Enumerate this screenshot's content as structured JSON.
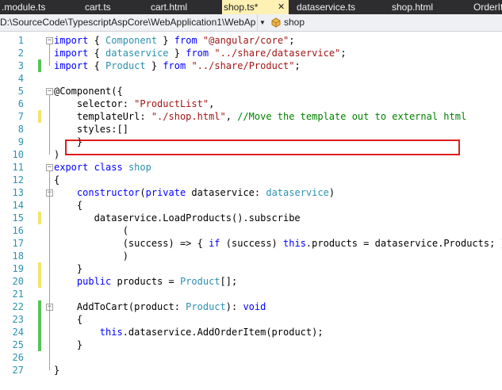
{
  "tabs": [
    {
      "label": ".module.ts"
    },
    {
      "label": "cart.ts"
    },
    {
      "label": "cart.html"
    },
    {
      "label": "shop.ts*",
      "active": true
    },
    {
      "label": "dataservice.ts"
    },
    {
      "label": "shop.html"
    },
    {
      "label": "OrderIt"
    }
  ],
  "navbar": {
    "path": "D:\\SourceCode\\TypescriptAspCore\\WebApplication1\\WebAp",
    "member": "shop"
  },
  "colors": {
    "modified": "#f2e46a",
    "saved": "#57c35a",
    "highlight_box": "#e21b1b",
    "line_numbers": "#2b91af"
  },
  "lines": [
    {
      "n": "1",
      "mark": "",
      "segments": [
        {
          "t": "import",
          "c": "kw"
        },
        {
          "t": " { "
        },
        {
          "t": "Component",
          "c": "ty"
        },
        {
          "t": " } "
        },
        {
          "t": "from",
          "c": "kw"
        },
        {
          "t": " "
        },
        {
          "t": "\"@angular/core\"",
          "c": "st"
        },
        {
          "t": ";"
        }
      ]
    },
    {
      "n": "2",
      "mark": "",
      "segments": [
        {
          "t": "import",
          "c": "kw"
        },
        {
          "t": " { "
        },
        {
          "t": "dataservice",
          "c": "ty"
        },
        {
          "t": " } "
        },
        {
          "t": "from",
          "c": "kw"
        },
        {
          "t": " "
        },
        {
          "t": "\"../share/dataservice\"",
          "c": "st"
        },
        {
          "t": ";"
        }
      ]
    },
    {
      "n": "3",
      "mark": "saved",
      "segments": [
        {
          "t": "import",
          "c": "kw"
        },
        {
          "t": " { "
        },
        {
          "t": "Product",
          "c": "ty"
        },
        {
          "t": " } "
        },
        {
          "t": "from",
          "c": "kw"
        },
        {
          "t": " "
        },
        {
          "t": "\"../share/Product\"",
          "c": "st"
        },
        {
          "t": ";"
        }
      ]
    },
    {
      "n": "4",
      "mark": "",
      "segments": []
    },
    {
      "n": "5",
      "mark": "",
      "segments": [
        {
          "t": "@Component({"
        }
      ]
    },
    {
      "n": "6",
      "mark": "",
      "segments": [
        {
          "t": "    selector: "
        },
        {
          "t": "\"ProductList\"",
          "c": "st"
        },
        {
          "t": ","
        }
      ]
    },
    {
      "n": "7",
      "mark": "modified",
      "segments": [
        {
          "t": "    templateUrl: "
        },
        {
          "t": "\"./shop.html\"",
          "c": "st"
        },
        {
          "t": ", "
        },
        {
          "t": "//Move the template out to external html",
          "c": "cm"
        }
      ]
    },
    {
      "n": "8",
      "mark": "",
      "segments": [
        {
          "t": "    styles:[]"
        }
      ]
    },
    {
      "n": "9",
      "mark": "",
      "segments": [
        {
          "t": "    }"
        }
      ]
    },
    {
      "n": "10",
      "mark": "",
      "segments": [
        {
          "t": ")"
        }
      ]
    },
    {
      "n": "11",
      "mark": "",
      "segments": [
        {
          "t": "export",
          "c": "kw"
        },
        {
          "t": " "
        },
        {
          "t": "class",
          "c": "kw"
        },
        {
          "t": " "
        },
        {
          "t": "shop",
          "c": "ty"
        }
      ]
    },
    {
      "n": "12",
      "mark": "",
      "segments": [
        {
          "t": "{"
        }
      ]
    },
    {
      "n": "13",
      "mark": "",
      "segments": [
        {
          "t": "    "
        },
        {
          "t": "constructor",
          "c": "kw"
        },
        {
          "t": "("
        },
        {
          "t": "private",
          "c": "kw"
        },
        {
          "t": " dataservice: "
        },
        {
          "t": "dataservice",
          "c": "ty"
        },
        {
          "t": ")"
        }
      ]
    },
    {
      "n": "14",
      "mark": "",
      "segments": [
        {
          "t": "    {"
        }
      ]
    },
    {
      "n": "15",
      "mark": "modified",
      "segments": [
        {
          "t": "       dataservice.LoadProducts().subscribe"
        }
      ]
    },
    {
      "n": "16",
      "mark": "",
      "segments": [
        {
          "t": "            ("
        }
      ]
    },
    {
      "n": "17",
      "mark": "",
      "segments": [
        {
          "t": "            (success) => { "
        },
        {
          "t": "if",
          "c": "kw"
        },
        {
          "t": " (success) "
        },
        {
          "t": "this",
          "c": "kw"
        },
        {
          "t": ".products = dataservice.Products; }"
        }
      ]
    },
    {
      "n": "18",
      "mark": "",
      "segments": [
        {
          "t": "            )"
        }
      ]
    },
    {
      "n": "19",
      "mark": "modified",
      "segments": [
        {
          "t": "    }"
        }
      ]
    },
    {
      "n": "20",
      "mark": "modified",
      "segments": [
        {
          "t": "    "
        },
        {
          "t": "public",
          "c": "kw"
        },
        {
          "t": " products = "
        },
        {
          "t": "Product",
          "c": "ty"
        },
        {
          "t": "[];"
        }
      ]
    },
    {
      "n": "21",
      "mark": "",
      "segments": []
    },
    {
      "n": "22",
      "mark": "saved",
      "segments": [
        {
          "t": "    AddToCart(product: "
        },
        {
          "t": "Product",
          "c": "ty"
        },
        {
          "t": "): "
        },
        {
          "t": "void",
          "c": "kw"
        }
      ]
    },
    {
      "n": "23",
      "mark": "saved",
      "segments": [
        {
          "t": "    {"
        }
      ]
    },
    {
      "n": "24",
      "mark": "saved",
      "segments": [
        {
          "t": "        "
        },
        {
          "t": "this",
          "c": "kw"
        },
        {
          "t": ".dataservice.AddOrderItem(product);"
        }
      ]
    },
    {
      "n": "25",
      "mark": "saved",
      "segments": [
        {
          "t": "    }"
        }
      ]
    },
    {
      "n": "26",
      "mark": "",
      "segments": []
    },
    {
      "n": "27",
      "mark": "",
      "segments": [
        {
          "t": "}"
        }
      ]
    }
  ]
}
